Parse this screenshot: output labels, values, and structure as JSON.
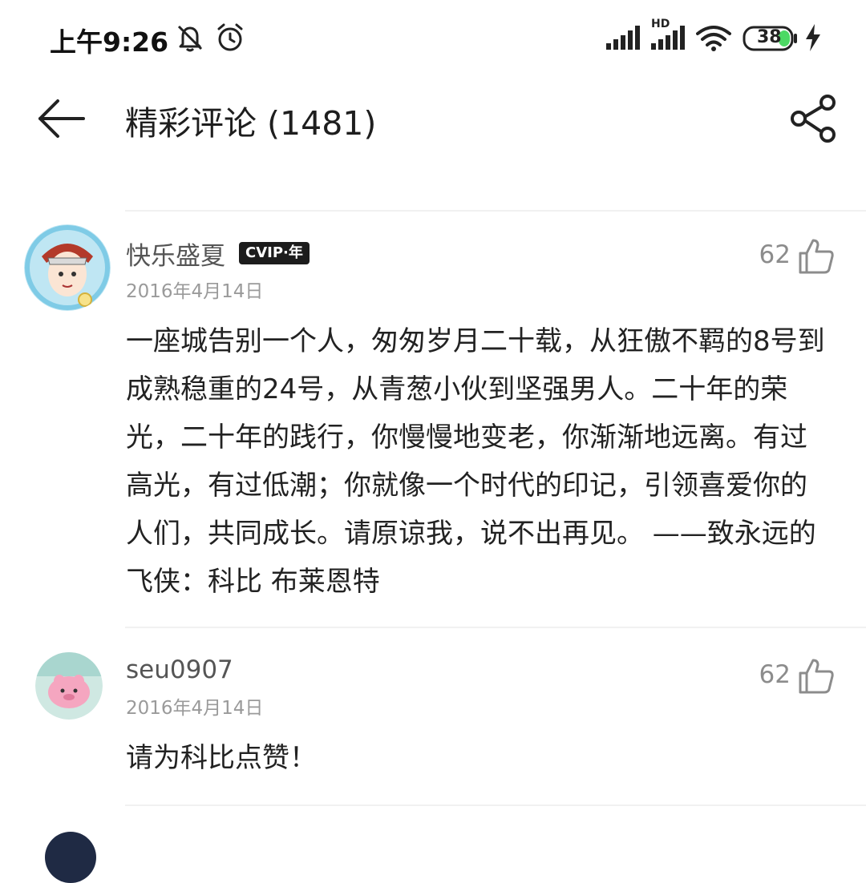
{
  "status_bar": {
    "time": "上午9:26",
    "network": "HD",
    "battery": "38",
    "icons": [
      "bell-off-icon",
      "alarm-icon",
      "signal-icon",
      "hd-signal-icon",
      "wifi-icon",
      "battery-icon",
      "charging-icon"
    ]
  },
  "header": {
    "title": "精彩评论 (1481)",
    "back_icon": "arrow-left-icon",
    "share_icon": "share-icon"
  },
  "comments": [
    {
      "username": "快乐盛夏",
      "vip_badge": "CVIP·年",
      "date": "2016年4月14日",
      "likes": "62",
      "text": "一座城告别一个人，匆匆岁月二十载，从狂傲不羁的8号到成熟稳重的24号，从青葱小伙到坚强男人。二十年的荣光，二十年的践行，你慢慢地变老，你渐渐地远离。有过高光，有过低潮；你就像一个时代的印记，引领喜爱你的人们，共同成长。请原谅我，说不出再见。 ——致永远的飞侠：科比 布莱恩特"
    },
    {
      "username": "seu0907",
      "date": "2016年4月14日",
      "likes": "62",
      "text": "请为科比点赞！"
    }
  ],
  "colors": {
    "text_primary": "#222222",
    "text_secondary": "#9a9a9a",
    "username": "#555555",
    "vip_bg": "#1c1c1c",
    "battery_fill": "#4cd964"
  }
}
